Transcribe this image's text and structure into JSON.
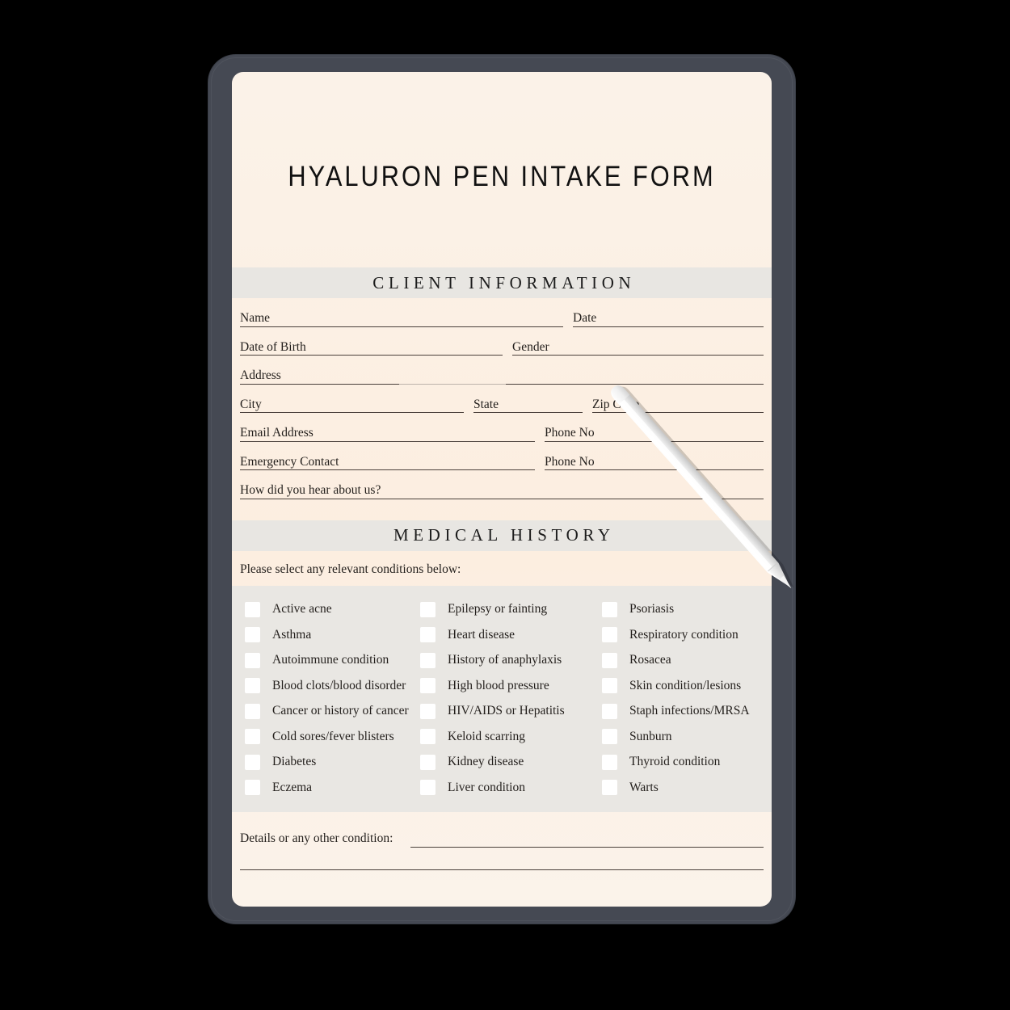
{
  "device": {
    "frame_color": "#454953",
    "page_bg": "#fcefe3",
    "band_color": "#e8e6e2"
  },
  "document": {
    "title": "HYALURON PEN INTAKE FORM"
  },
  "client_information": {
    "heading": "CLIENT INFORMATION",
    "rows": [
      {
        "fields": [
          {
            "label": "Name"
          },
          {
            "label": "Date"
          }
        ]
      },
      {
        "fields": [
          {
            "label": "Date of Birth"
          },
          {
            "label": "Gender"
          }
        ]
      },
      {
        "fields": [
          {
            "label": "Address"
          },
          {
            "label": ""
          }
        ]
      },
      {
        "fields": [
          {
            "label": "City"
          },
          {
            "label": "State"
          },
          {
            "label": "Zip Code"
          }
        ]
      },
      {
        "fields": [
          {
            "label": "Email Address"
          },
          {
            "label": "Phone No"
          }
        ]
      },
      {
        "fields": [
          {
            "label": "Emergency Contact"
          },
          {
            "label": "Phone No"
          }
        ]
      },
      {
        "fields": [
          {
            "label": "How did you hear about us?"
          }
        ]
      }
    ],
    "labels": {
      "name": "Name",
      "date": "Date",
      "date_of_birth": "Date of Birth",
      "gender": "Gender",
      "address": "Address",
      "address_line2": "",
      "city": "City",
      "state": "State",
      "zip_code": "Zip Code",
      "email_address": "Email Address",
      "phone_no_1": "Phone No",
      "emergency_contact": "Emergency Contact",
      "phone_no_2": "Phone No",
      "how_did_you_hear": "How did you hear about us?"
    }
  },
  "medical_history": {
    "heading": "MEDICAL HISTORY",
    "instruction": "Please select any relevant conditions below:",
    "columns": [
      {
        "items": [
          "Active acne",
          "Asthma",
          "Autoimmune condition",
          "Blood clots/blood disorder",
          "Cancer or history of cancer",
          "Cold sores/fever blisters",
          "Diabetes",
          "Eczema"
        ]
      },
      {
        "items": [
          "Epilepsy or fainting",
          "Heart disease",
          "History of anaphylaxis",
          "High blood pressure",
          "HIV/AIDS or Hepatitis",
          "Keloid scarring",
          "Kidney disease",
          "Liver condition"
        ]
      },
      {
        "items": [
          "Psoriasis",
          "Respiratory condition",
          "Rosacea",
          "Skin condition/lesions",
          "Staph infections/MRSA",
          "Sunburn",
          "Thyroid condition",
          "Warts"
        ]
      }
    ],
    "details_label": "Details or any other condition:"
  },
  "accessories": {
    "stylus": "stylus-pen"
  }
}
